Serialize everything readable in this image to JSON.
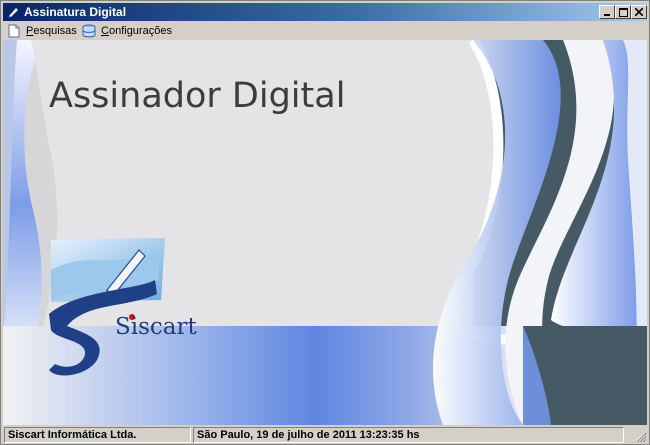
{
  "window": {
    "title": "Assinatura Digital",
    "buttons": [
      "minimize",
      "maximize",
      "close"
    ]
  },
  "menu": [
    {
      "label": "Pesquisas",
      "icon": "document-icon"
    },
    {
      "label": "Configurações",
      "icon": "database-icon"
    }
  ],
  "main": {
    "app_title": "Assinador Digital",
    "logo_text": "Siscart",
    "colors": {
      "accent_blue": "#5b86e5",
      "dark_slate": "#2f4f5f",
      "logo_red": "#d01010"
    }
  },
  "status": {
    "company": "Siscart Informática Ltda.",
    "datetime": "São Paulo, 19 de julho de 2011  13:23:35 hs"
  }
}
